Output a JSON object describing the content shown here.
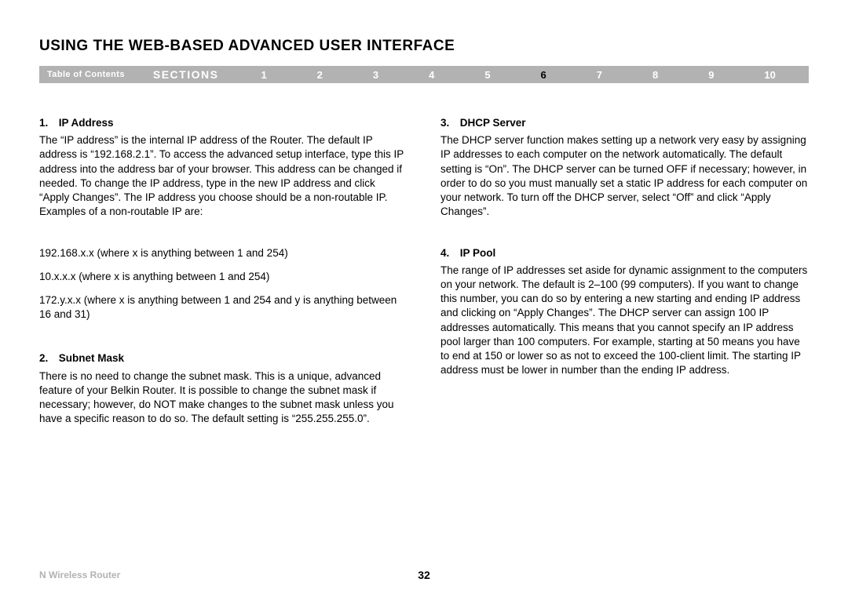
{
  "title": "USING THE WEB-BASED ADVANCED USER INTERFACE",
  "nav": {
    "toc": "Table of Contents",
    "sections_label": "SECTIONS",
    "numbers": [
      "1",
      "2",
      "3",
      "4",
      "5",
      "6",
      "7",
      "8",
      "9",
      "10"
    ],
    "active": "6"
  },
  "left": {
    "h1": "1. IP Address",
    "p1": "The “IP address” is the internal IP address of the Router. The default IP address is “192.168.2.1”. To access the advanced setup interface, type this IP address into the address bar of your browser. This address can be changed if needed. To change the IP address, type in the new IP address and click “Apply Changes”. The IP address you choose should be a non-routable IP. Examples of a non-routable IP are:",
    "ex1": "192.168.x.x (where x is anything between 1 and 254)",
    "ex2": "10.x.x.x (where x is anything between 1 and 254)",
    "ex3": "172.y.x.x (where x is anything between 1 and 254 and y is anything between 16 and 31)",
    "h2": "2. Subnet Mask",
    "p2": "There is no need to change the subnet mask. This is a unique, advanced feature of your Belkin Router. It is possible to change the subnet mask if necessary; however, do NOT make changes to the subnet mask unless you have a specific reason to do so. The default setting is “255.255.255.0”."
  },
  "right": {
    "h3": "3. DHCP Server",
    "p3": "The DHCP server function makes setting up a network very easy by assigning IP addresses to each computer on the network automatically. The default setting is “On”. The DHCP server can be turned OFF if necessary; however, in order to do so you must manually set a static IP address for each computer on your network. To turn off the DHCP server, select “Off” and click “Apply Changes”.",
    "h4": "4. IP Pool",
    "p4": "The range of IP addresses set aside for dynamic assignment to the computers on your network. The default is 2–100 (99 computers). If you want to change this number, you can do so by entering a new starting and ending IP address and clicking on “Apply Changes”. The DHCP server can assign 100 IP addresses automatically. This means that you cannot specify an IP address pool larger than 100 computers. For example, starting at 50 means you have to end at 150 or lower so as not to exceed the 100-client limit. The starting IP address must be lower in number than the ending IP address."
  },
  "footer": {
    "product": "N Wireless Router",
    "page": "32"
  }
}
